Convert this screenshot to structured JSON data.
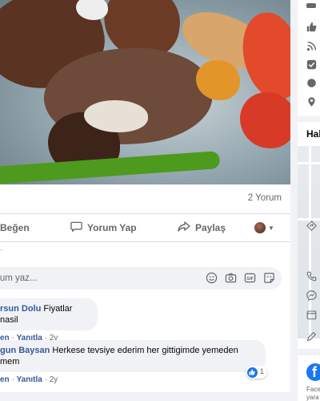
{
  "post": {
    "comments_count": "2 Yorum",
    "actions": {
      "like": "Beğen",
      "comment": "Yorum Yap",
      "share": "Paylaş"
    },
    "comment_input": {
      "placeholder": "rum yaz..."
    },
    "comments": [
      {
        "author": "rsun Dolu",
        "text": "Fiyatlar nasil",
        "like": "en",
        "reply": "Yanıtla",
        "time": "2y"
      },
      {
        "author": "gun Baysan",
        "text": "Herkese tevsiye ederim her gittigimde yemeden",
        "text2": "mem",
        "like": "en",
        "reply": "Yanıtla",
        "time": "2y",
        "reaction_count": "1"
      }
    ]
  },
  "sidebar": {
    "about_title": "Hak",
    "facebook_text_1": "Face",
    "facebook_text_2": "yara"
  },
  "colors": {
    "accent": "#1877f2",
    "link": "#385898",
    "muted": "#65676b"
  }
}
